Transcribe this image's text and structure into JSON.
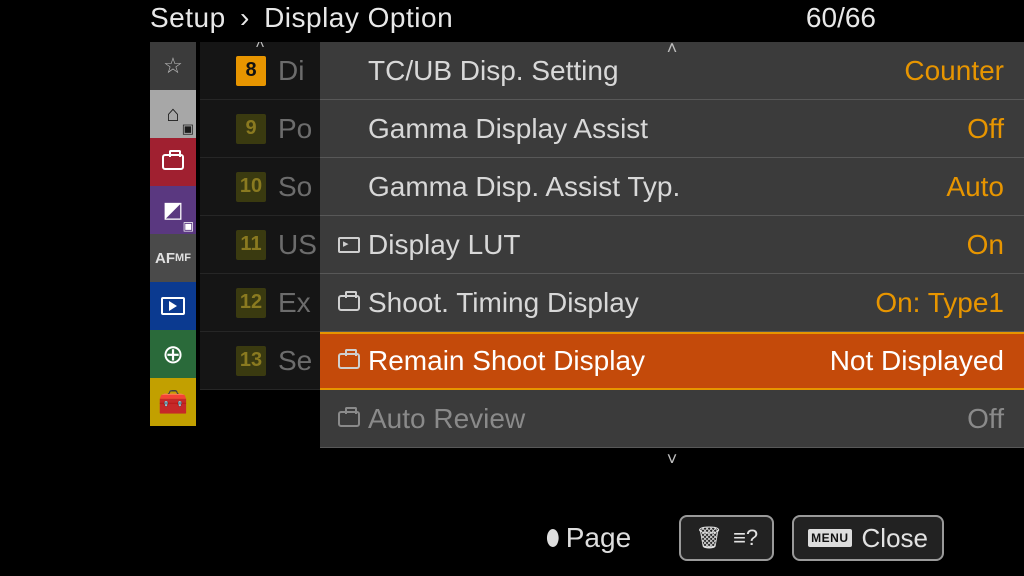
{
  "breadcrumb": {
    "root": "Setup",
    "leaf": "Display Option"
  },
  "page": {
    "current": "60",
    "total": "66"
  },
  "tabs": {
    "star": "☆",
    "home": "⌂",
    "af_main": "AF",
    "af_sub": "MF",
    "net": "⊕",
    "tool": "🧰"
  },
  "subcol": [
    {
      "num": "8",
      "label": "Di",
      "active": true
    },
    {
      "num": "9",
      "label": "Po",
      "active": false
    },
    {
      "num": "10",
      "label": "So",
      "active": false
    },
    {
      "num": "11",
      "label": "US",
      "active": false
    },
    {
      "num": "12",
      "label": "Ex",
      "active": false
    },
    {
      "num": "13",
      "label": "Se",
      "active": false
    }
  ],
  "rows": [
    {
      "label": "TC/UB Disp. Setting",
      "value": "Counter",
      "icon": "",
      "state": "normal"
    },
    {
      "label": "Gamma Display Assist",
      "value": "Off",
      "icon": "",
      "state": "normal"
    },
    {
      "label": "Gamma Disp. Assist Typ.",
      "value": "Auto",
      "icon": "",
      "state": "normal"
    },
    {
      "label": "Display LUT",
      "value": "On",
      "icon": "lut",
      "state": "normal"
    },
    {
      "label": "Shoot. Timing Display",
      "value": "On: Type1",
      "icon": "cam",
      "state": "normal"
    },
    {
      "label": "Remain Shoot Display",
      "value": "Not Displayed",
      "icon": "cam",
      "state": "selected"
    },
    {
      "label": "Auto Review",
      "value": "Off",
      "icon": "cam",
      "state": "disabled"
    }
  ],
  "footer": {
    "page_label": "Page",
    "close_label": "Close",
    "menu_chip": "MENU",
    "trash": "🗑",
    "help": "≡?"
  },
  "carets": {
    "up": "˄",
    "down": "˅"
  }
}
